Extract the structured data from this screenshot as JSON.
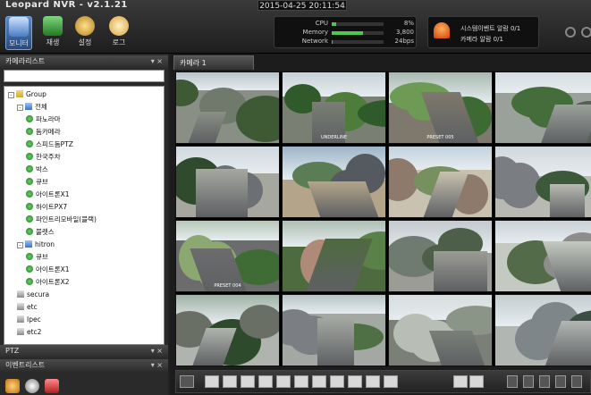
{
  "app": {
    "title": "Leopard NVR - v2.1.21",
    "clock": "2015-04-25 20:11:54"
  },
  "toolbar": [
    {
      "label": "모니터",
      "icon": "monitor-icon"
    },
    {
      "label": "재생",
      "icon": "playback-icon"
    },
    {
      "label": "설정",
      "icon": "settings-icon"
    },
    {
      "label": "로그",
      "icon": "log-icon"
    }
  ],
  "stats": {
    "cpu": {
      "label": "CPU",
      "value": "8%",
      "level": 0.08
    },
    "memory": {
      "label": "Memory",
      "value": "3,800",
      "level": 0.6
    },
    "network": {
      "label": "Network",
      "value": "24bps",
      "level": 0.02
    }
  },
  "alarm": {
    "line1": "시스템이벤트 알람 0/1",
    "line2": "카메라 알람 0/1"
  },
  "panels": {
    "camera_list": "카메라리스트",
    "ptz": "PTZ",
    "event_list": "이벤트리스트",
    "min_close": "▾  ×"
  },
  "tree": [
    {
      "label": "Group",
      "type": "folder",
      "depth": 0
    },
    {
      "label": "전체",
      "type": "server",
      "depth": 1
    },
    {
      "label": "파노라마",
      "type": "cam",
      "depth": 2
    },
    {
      "label": "돔카메라",
      "type": "cam",
      "depth": 2
    },
    {
      "label": "스피드돔PTZ",
      "type": "cam",
      "depth": 2
    },
    {
      "label": "한국주차",
      "type": "cam",
      "depth": 2
    },
    {
      "label": "박스",
      "type": "cam",
      "depth": 2
    },
    {
      "label": "큐브",
      "type": "cam",
      "depth": 2
    },
    {
      "label": "아이트론X1",
      "type": "cam",
      "depth": 2
    },
    {
      "label": "하이트PX7",
      "type": "cam",
      "depth": 2
    },
    {
      "label": "파인트리모바일(블랙)",
      "type": "cam",
      "depth": 2
    },
    {
      "label": "불렛스",
      "type": "cam",
      "depth": 2
    },
    {
      "label": "hitron",
      "type": "server",
      "depth": 1
    },
    {
      "label": "큐브",
      "type": "cam",
      "depth": 2
    },
    {
      "label": "아이트론X1",
      "type": "cam",
      "depth": 2
    },
    {
      "label": "아이트론X2",
      "type": "cam",
      "depth": 2
    },
    {
      "label": "secura",
      "type": "nvr",
      "depth": 1
    },
    {
      "label": "etc",
      "type": "nvr",
      "depth": 1
    },
    {
      "label": "Ipec",
      "type": "nvr",
      "depth": 1
    },
    {
      "label": "etc2",
      "type": "nvr",
      "depth": 1
    }
  ],
  "view": {
    "tab": "카메라 1"
  },
  "cameras": [
    {
      "label": ""
    },
    {
      "label": "UNDERLINE"
    },
    {
      "label": "PRESET 005"
    },
    {
      "label": ""
    },
    {
      "label": ""
    },
    {
      "label": ""
    },
    {
      "label": ""
    },
    {
      "label": ""
    },
    {
      "label": "PRESET 004"
    },
    {
      "label": ""
    },
    {
      "label": ""
    },
    {
      "label": ""
    },
    {
      "label": ""
    },
    {
      "label": ""
    },
    {
      "label": ""
    },
    {
      "label": ""
    }
  ]
}
